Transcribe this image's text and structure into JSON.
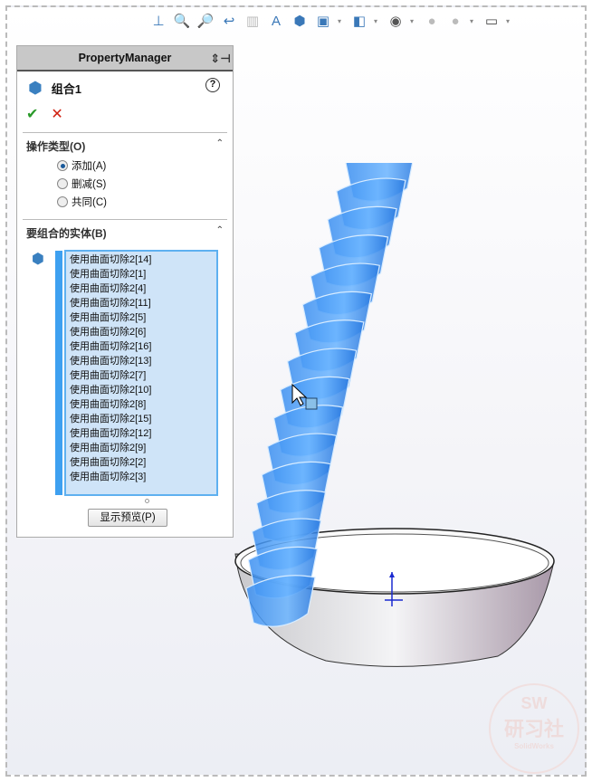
{
  "toolbar": {
    "icons": [
      "view-orient-icon",
      "zoom-to-fit-icon",
      "zoom-area-icon",
      "previous-view-icon",
      "section-view-icon",
      "dynamic-annotation-icon",
      "view-orientation-icon",
      "display-style-icon",
      "hide-show-icon",
      "edit-appearance-icon",
      "apply-scene-icon",
      "view-settings-icon"
    ]
  },
  "pm": {
    "title": "PropertyManager",
    "feature": "组合1",
    "help": "?",
    "ok": "✔",
    "cancel": "✕",
    "op_section": "操作类型(O)",
    "ops": [
      {
        "label": "添加(A)",
        "checked": true
      },
      {
        "label": "删减(S)",
        "checked": false
      },
      {
        "label": "共同(C)",
        "checked": false
      }
    ],
    "bodies_section": "要组合的实体(B)",
    "bodies": [
      "使用曲面切除2[14]",
      "使用曲面切除2[1]",
      "使用曲面切除2[4]",
      "使用曲面切除2[11]",
      "使用曲面切除2[5]",
      "使用曲面切除2[6]",
      "使用曲面切除2[16]",
      "使用曲面切除2[13]",
      "使用曲面切除2[7]",
      "使用曲面切除2[10]",
      "使用曲面切除2[8]",
      "使用曲面切除2[15]",
      "使用曲面切除2[12]",
      "使用曲面切除2[9]",
      "使用曲面切除2[2]",
      "使用曲面切除2[3]"
    ],
    "preview": "显示预览(P)"
  },
  "watermark": {
    "top": "SW",
    "main": "研习社",
    "sub": "SolidWorks"
  }
}
